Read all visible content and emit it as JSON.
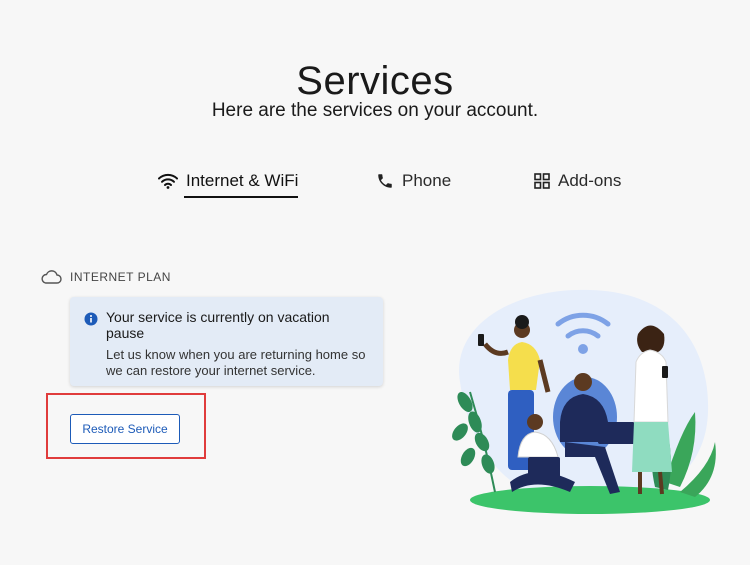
{
  "page": {
    "title": "Services",
    "subtitle": "Here are the services on your account."
  },
  "tabs": [
    {
      "label": "Internet & WiFi",
      "icon": "wifi-icon",
      "active": true
    },
    {
      "label": "Phone",
      "icon": "phone-icon",
      "active": false
    },
    {
      "label": "Add-ons",
      "icon": "grid-icon",
      "active": false
    }
  ],
  "plan": {
    "label": "INTERNET PLAN",
    "icon": "cloud-icon"
  },
  "alert": {
    "icon": "info-icon",
    "title": "Your service is currently on vacation pause",
    "body": "Let us know when you are returning home so we can restore your internet service."
  },
  "actions": {
    "restore_label": "Restore Service"
  },
  "colors": {
    "accent": "#1d5bb8",
    "alert_bg": "#e3ebf6",
    "highlight": "#e03c3c"
  }
}
